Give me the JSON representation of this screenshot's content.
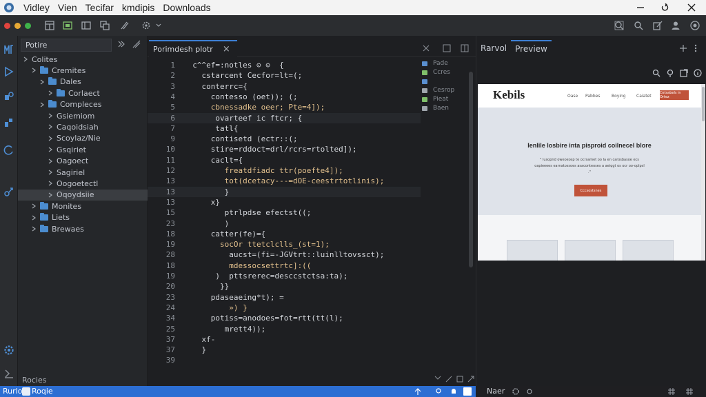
{
  "menu": [
    "Vidley",
    "Vien",
    "Tecifar",
    "kmdipis",
    "Downloads"
  ],
  "explorer": {
    "title": "Potire",
    "items": [
      {
        "label": "Colites",
        "depth": 0,
        "expanded": true,
        "folder": false
      },
      {
        "label": "Cremites",
        "depth": 1,
        "folder": true
      },
      {
        "label": "Dales",
        "depth": 2,
        "folder": true
      },
      {
        "label": "Corlaect",
        "depth": 3,
        "folder": true
      },
      {
        "label": "Compleces",
        "depth": 2,
        "folder": true
      },
      {
        "label": "Gsiemiom",
        "depth": 3,
        "folder": false
      },
      {
        "label": "Caqoidsiah",
        "depth": 3,
        "folder": false
      },
      {
        "label": "Scoylaz/Nie",
        "depth": 3,
        "folder": false
      },
      {
        "label": "Gsqiriet",
        "depth": 3,
        "folder": false
      },
      {
        "label": "Oagoect",
        "depth": 3,
        "folder": false
      },
      {
        "label": "Sagiriel",
        "depth": 3,
        "folder": false
      },
      {
        "label": "Oogoetectl",
        "depth": 3,
        "folder": false
      },
      {
        "label": "Oqoydsiie",
        "depth": 3,
        "folder": false,
        "selected": true
      },
      {
        "label": "Monites",
        "depth": 1,
        "folder": true
      },
      {
        "label": "Liets",
        "depth": 1,
        "folder": true
      },
      {
        "label": "Brewaes",
        "depth": 1,
        "folder": true
      }
    ],
    "footer": "Rocies"
  },
  "editor": {
    "tab_label": "Porimdesh plotr",
    "close": "×",
    "lines": [
      {
        "n": "1",
        "code": "  c^^ef=:notles ⊙ ⊙  {",
        "color": "#d4d7dc"
      },
      {
        "n": "2",
        "code": "    cstarcent Cecfor=lt=(;",
        "color": "#d4d7dc"
      },
      {
        "n": "3",
        "code": "    conterrc={",
        "color": "#d4d7dc"
      },
      {
        "n": "4",
        "code": "      contesso (oet)); (;",
        "color": "#d4d7dc"
      },
      {
        "n": "5",
        "code": "      cbnessadke oeer; Pte=4]);",
        "color": "#e2c08d"
      },
      {
        "n": "6",
        "code": "       ovarteef ic ftcr; {",
        "color": "#d4d7dc"
      },
      {
        "n": "7",
        "code": "       tatl{",
        "color": "#d4d7dc"
      },
      {
        "n": "9",
        "code": "      contisetd (ectr::(;",
        "color": "#d4d7dc"
      },
      {
        "n": "10",
        "code": "      stire=rddoct=drl/rcrs=rtolted]);",
        "color": "#d4d7dc"
      },
      {
        "n": "11",
        "code": "      caclt={",
        "color": "#d4d7dc"
      },
      {
        "n": "12",
        "code": "         freatdfiadc ttr(poefte4]);",
        "color": "#e2c08d"
      },
      {
        "n": "13",
        "code": "         tot(dcetacy---=dOE-ceestrtotlinis);",
        "color": "#e2c08d"
      },
      {
        "n": "13",
        "code": "         }",
        "color": "#d4d7dc"
      },
      {
        "n": "13",
        "code": "      x}",
        "color": "#d4d7dc"
      },
      {
        "n": "15",
        "code": "         ptrlpdse efectst((;",
        "color": "#d4d7dc"
      },
      {
        "n": "23",
        "code": "         )",
        "color": "#d4d7dc"
      },
      {
        "n": "18",
        "code": "      catter(fe)={",
        "color": "#d4d7dc"
      },
      {
        "n": "19",
        "code": "        socOr ttetclclls_(st=1);",
        "color": "#e2c08d"
      },
      {
        "n": "28",
        "code": "          aucst=(fi=-JGVtrt::luinlltovssct);",
        "color": "#d4d7dc"
      },
      {
        "n": "18",
        "code": "          mdessocsettrtc]:((",
        "color": "#e2c08d"
      },
      {
        "n": "19",
        "code": "       )  pttsrerec=desccstctsa:ta);",
        "color": "#d4d7dc"
      },
      {
        "n": "20",
        "code": "        }}",
        "color": "#d4d7dc"
      },
      {
        "n": "23",
        "code": "      pdaseaeing*t); =",
        "color": "#d4d7dc"
      },
      {
        "n": "24",
        "code": "          ») }",
        "color": "#e2c08d"
      },
      {
        "n": "34",
        "code": "      potiss=anodoes=fot=rtt(tt(l);",
        "color": "#d4d7dc"
      },
      {
        "n": "25",
        "code": "         mrett4));",
        "color": "#d4d7dc"
      },
      {
        "n": "37",
        "code": "    xf-",
        "color": "#d4d7dc"
      },
      {
        "n": "37",
        "code": "    }",
        "color": "#d4d7dc"
      },
      {
        "n": "39",
        "code": "",
        "color": "#d4d7dc"
      }
    ],
    "minimap": [
      "Pade",
      "Ccres",
      "",
      "Cesrop",
      "Pieat",
      "Baen"
    ]
  },
  "preview": {
    "tab_inactive": "Rarvol",
    "tab_active": "Preview",
    "site": {
      "logo": "Kebils",
      "nav": [
        "Oase",
        "Pabbes",
        "Boying",
        "Caiatet"
      ],
      "nav_cta": "Cetsabels in Ortez",
      "hero_title": "Ienlile losbire inta pisproid coilnecel blore",
      "hero_sub": "\" lusopnd oweoeosp te ocrsamet oo Ia en carosbasoe ecs oapieeees earnatossoes asaconteoses a aeiqgt os ocr oo-oplpsl .\"",
      "hero_button": "Cccsostsnes"
    },
    "footer": "Naer"
  },
  "status": {
    "left1": "Rurlo",
    "left2": "Roqie"
  }
}
